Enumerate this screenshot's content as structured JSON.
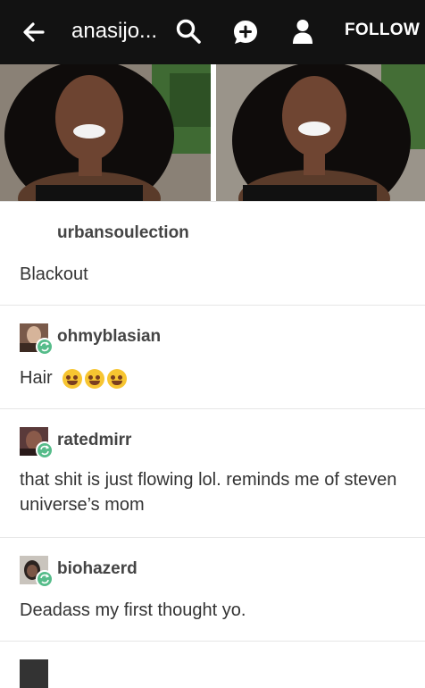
{
  "header": {
    "blog_title": "anasijo...",
    "follow_label": "FOLLOW",
    "icons": [
      "back-arrow-icon",
      "search-icon",
      "message-icon",
      "person-icon"
    ]
  },
  "photos": [
    "photo-left",
    "photo-right"
  ],
  "thread": [
    {
      "username": "urbansoulection",
      "text": "Blackout",
      "reblogged": false
    },
    {
      "username": "ohmyblasian",
      "text": "Hair",
      "emoji_count": 3,
      "reblogged": true
    },
    {
      "username": "ratedmirr",
      "text": "that shit is just flowing lol. reminds me of steven universe’s mom",
      "reblogged": true
    },
    {
      "username": "biohazerd",
      "text": "Deadass my first thought yo.",
      "reblogged": true
    }
  ],
  "colors": {
    "topbar": "#121212",
    "reblog_badge": "#56bc8a",
    "divider": "#e6e6e6"
  }
}
